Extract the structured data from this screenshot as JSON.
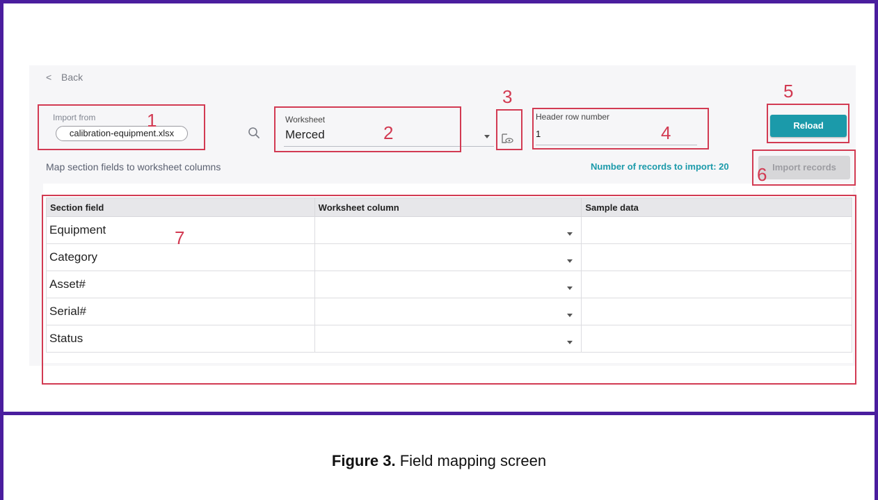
{
  "nav": {
    "back_chevron": "<",
    "back_label": "Back"
  },
  "import_from": {
    "label": "Import from",
    "file": "calibration-equipment.xlsx"
  },
  "worksheet": {
    "label": "Worksheet",
    "value": "Merced"
  },
  "header_row": {
    "label": "Header row number",
    "value": "1"
  },
  "buttons": {
    "reload": "Reload",
    "import_records": "Import records"
  },
  "mapping": {
    "title": "Map section fields to worksheet columns",
    "records_to_import": "Number of records to import: 20"
  },
  "table": {
    "headers": [
      "Section field",
      "Worksheet column",
      "Sample data"
    ],
    "rows": [
      {
        "field": "Equipment",
        "column": "",
        "sample": ""
      },
      {
        "field": "Category",
        "column": "",
        "sample": ""
      },
      {
        "field": "Asset#",
        "column": "",
        "sample": ""
      },
      {
        "field": "Serial#",
        "column": "",
        "sample": ""
      },
      {
        "field": "Status",
        "column": "",
        "sample": ""
      }
    ]
  },
  "callouts": [
    "1",
    "2",
    "3",
    "4",
    "5",
    "6",
    "7"
  ],
  "caption": {
    "bold": "Figure 3.",
    "text": "Field mapping screen"
  },
  "colors": {
    "accent": "#1b9aaa",
    "callout": "#d23a52",
    "frame": "#4a1e9e"
  },
  "icons": [
    "search-icon",
    "preview-icon",
    "chevron-down-icon"
  ]
}
